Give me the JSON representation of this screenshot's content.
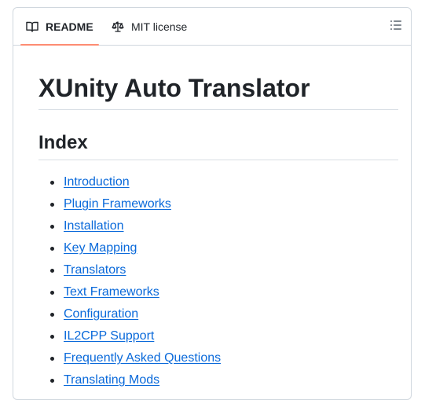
{
  "tabs": {
    "readme_label": "README",
    "license_label": "MIT license"
  },
  "icons": {
    "readme": "book-icon",
    "license": "law-scale-icon",
    "outline": "list-unordered-icon"
  },
  "colors": {
    "link": "#0969da",
    "active_tab_underline": "#fd8c73",
    "border": "#d0d7de"
  },
  "content": {
    "title": "XUnity Auto Translator",
    "index_heading": "Index",
    "index_items": [
      "Introduction",
      "Plugin Frameworks",
      "Installation",
      "Key Mapping",
      "Translators",
      "Text Frameworks",
      "Configuration",
      "IL2CPP Support",
      "Frequently Asked Questions",
      "Translating Mods"
    ]
  }
}
